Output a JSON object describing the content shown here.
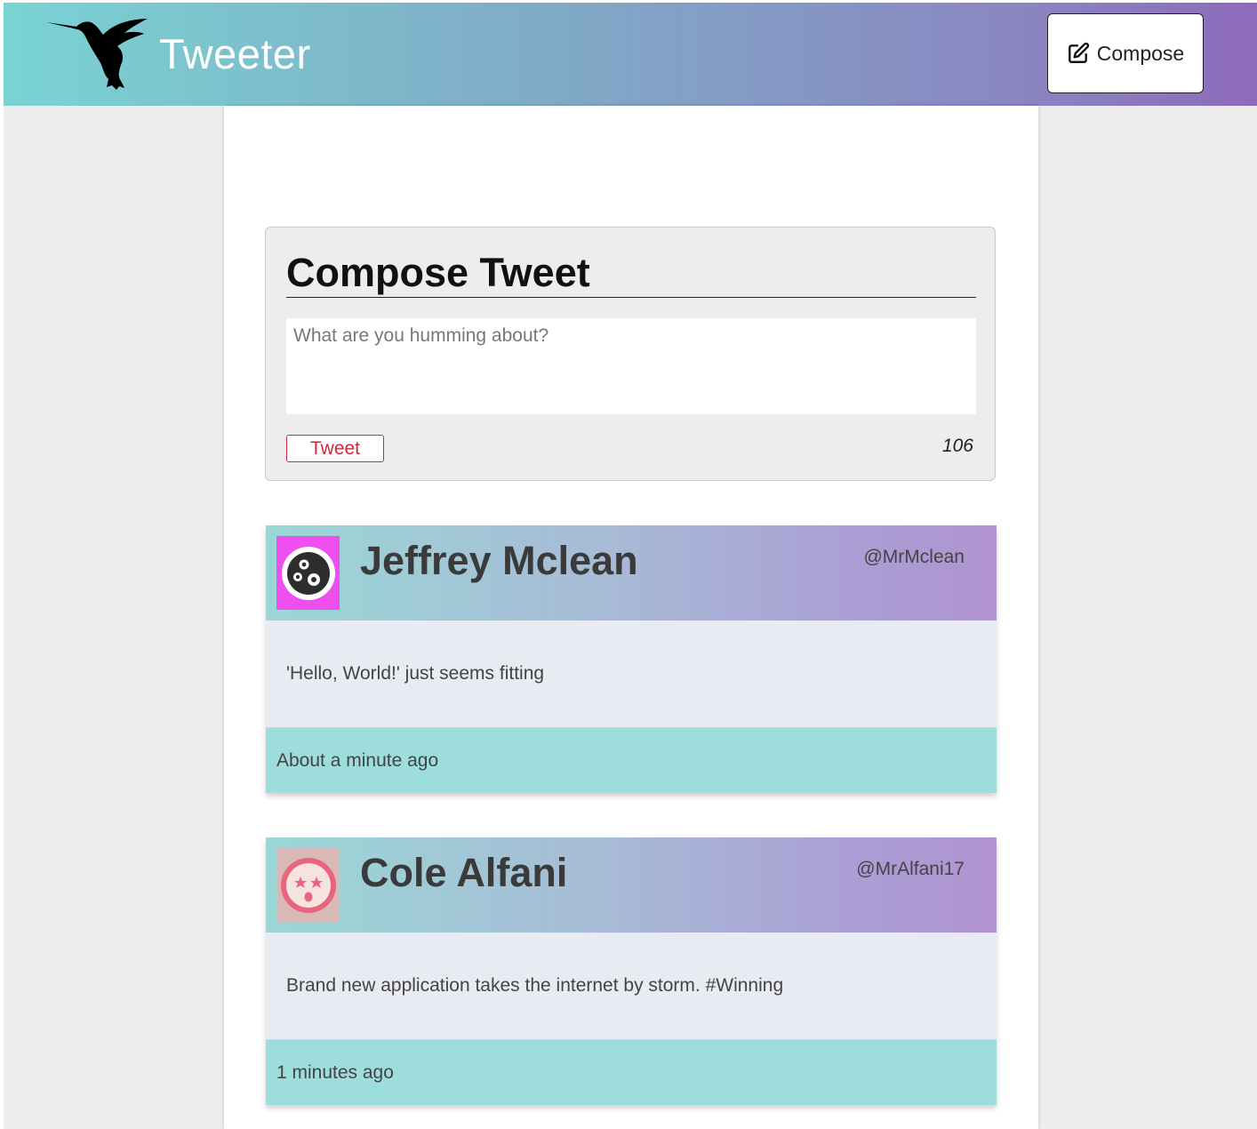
{
  "nav": {
    "brand": "Tweeter",
    "logo_icon": "hummingbird-icon",
    "compose_label": "Compose",
    "compose_icon": "edit-icon"
  },
  "compose": {
    "title": "Compose Tweet",
    "placeholder": "What are you humming about?",
    "value": "",
    "tweet_label": "Tweet",
    "counter": "106",
    "accent": "#d0283c"
  },
  "tweets": [
    {
      "name": "Jeffrey Mclean",
      "handle": "@MrMclean",
      "avatar_icon": "face-avatar-icon",
      "avatar_color": "#f04ff0",
      "text": "'Hello, World!' just seems fitting",
      "time": "About a minute ago"
    },
    {
      "name": "Cole Alfani",
      "handle": "@MrAlfani17",
      "avatar_icon": "star-eyes-avatar-icon",
      "avatar_color": "#d9b8b8",
      "text": "Brand new application takes the internet by storm. #Winning",
      "time": "1 minutes ago"
    }
  ],
  "colors": {
    "nav_gradient_start": "#7ad3d3",
    "nav_gradient_end": "#8e6bbb",
    "tweet_footer": "#9ddedd",
    "tweet_body": "#e8ebf2"
  }
}
